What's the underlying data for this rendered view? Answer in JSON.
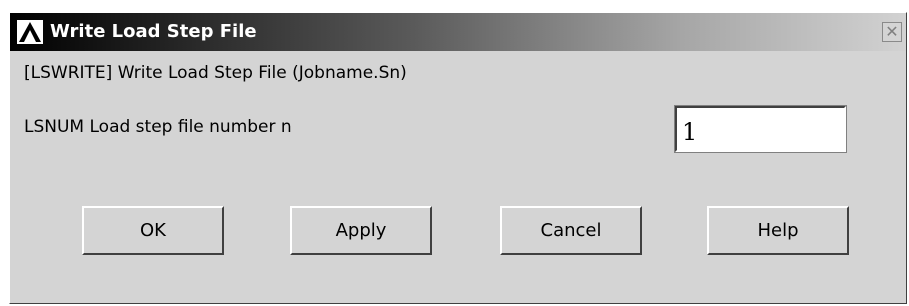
{
  "window": {
    "title": "Write Load Step File",
    "close_glyph": "✕",
    "icon": "ansys-logo-icon"
  },
  "form": {
    "description": "[LSWRITE]  Write Load Step File (Jobname.Sn)",
    "field_label": "LSNUM  Load step file number n",
    "field_value": "1"
  },
  "buttons": {
    "ok": "OK",
    "apply": "Apply",
    "cancel": "Cancel",
    "help": "Help"
  },
  "colors": {
    "dialog_background": "#d4d4d4",
    "titlebar_start": "#000000",
    "titlebar_end": "#d2d2d2"
  }
}
